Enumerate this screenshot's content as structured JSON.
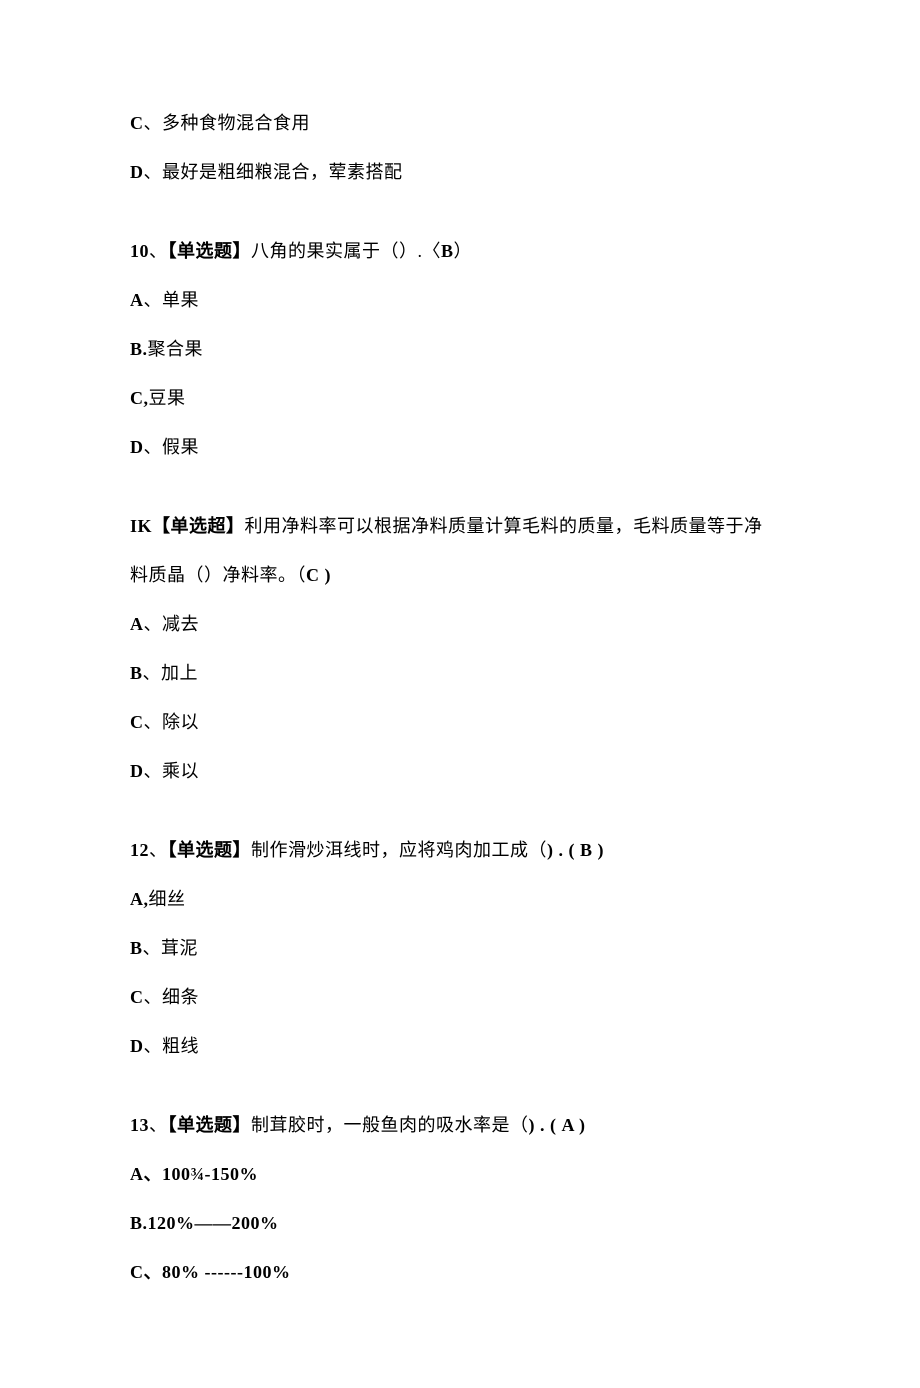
{
  "q9": {
    "optC_prefix": "C",
    "optC_sep": "、",
    "optC_text": "多种食物混合食用",
    "optD_prefix": "D",
    "optD_sep": "、最好是粗细粮混合，荤素搭配"
  },
  "q10": {
    "num": "10",
    "sep": "、",
    "tag": "【单选题】",
    "stem": "八角的果实属于（）.〈",
    "ans": "B",
    "close": "）",
    "optA_prefix": "A",
    "optA_text": "、单果",
    "optB_prefix": "B.",
    "optB_text": "聚合果",
    "optC_prefix": "C,",
    "optC_text": "豆果",
    "optD_prefix": "D",
    "optD_text": "、假果"
  },
  "q11": {
    "num_tag": "IK【单选超】",
    "stem1": "利用净料率可以根据净料质量计算毛料的质量，毛料质量等于净",
    "stem2a": "料质晶（）净料率。（",
    "ans": "C )",
    "optA_prefix": "A",
    "optA_text": "、减去",
    "optB_prefix": "B",
    "optB_text": "、加上",
    "optC_prefix": "C",
    "optC_text": "、除以",
    "optD_prefix": "D",
    "optD_text": "、乘以"
  },
  "q12": {
    "num": "12",
    "sep": "、",
    "tag": "【单选题】",
    "stem": "制作滑炒洱线时，应将鸡肉加工成（",
    "close1": ") . ( ",
    "ans": "B )",
    "optA_prefix": "A,",
    "optA_text": "细丝",
    "optB_prefix": "B",
    "optB_text": "、茸泥",
    "optC_prefix": "C",
    "optC_text": "、细条",
    "optD_prefix": "D",
    "optD_text": "、粗线"
  },
  "q13": {
    "num": "13",
    "sep": "、",
    "tag": "【单选题】",
    "stem": "制茸胶时，一般鱼肉的吸水率是（",
    "close1": ") . ( ",
    "ans": "A )",
    "optA": "A、100¾-150%",
    "optB": "B.120%——200%",
    "optC": "C、80% ------100%"
  }
}
